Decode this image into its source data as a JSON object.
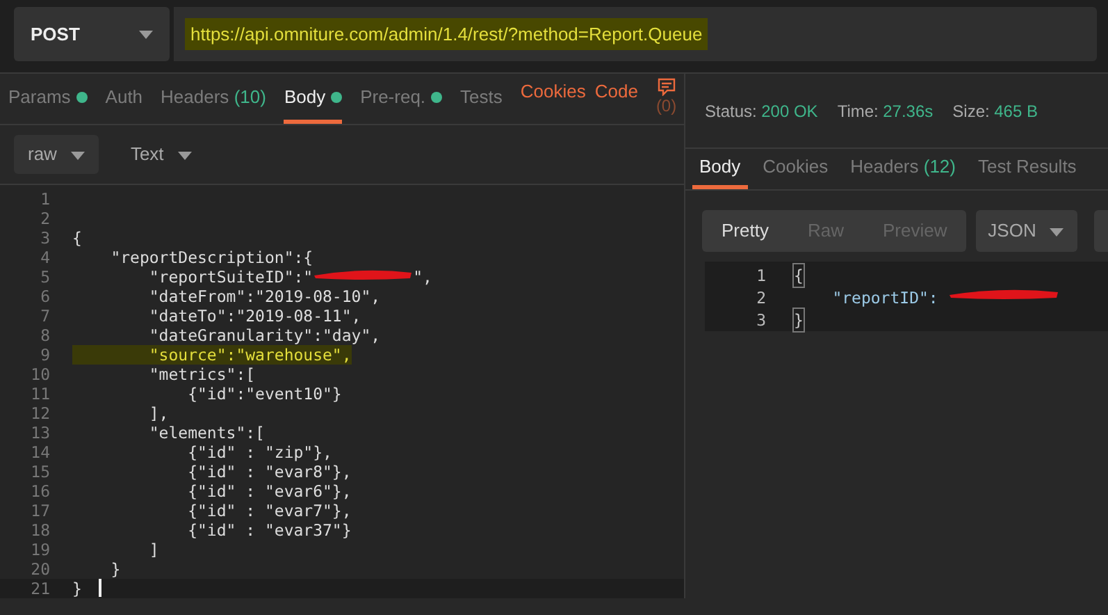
{
  "request": {
    "method": "POST",
    "url": "https://api.omniture.com/admin/1.4/rest/?method=Report.Queue",
    "url_highlighted": true
  },
  "request_tabs": [
    {
      "label": "Params",
      "dot": true,
      "selected": false
    },
    {
      "label": "Auth",
      "selected": false
    },
    {
      "label": "Headers",
      "count": "(10)",
      "selected": false
    },
    {
      "label": "Body",
      "dot": true,
      "selected": true
    },
    {
      "label": "Pre-req.",
      "dot": true,
      "selected": false
    },
    {
      "label": "Tests",
      "selected": false
    }
  ],
  "request_links": [
    "Cookies",
    "Code"
  ],
  "comments_count": "(0)",
  "body_mode": "raw",
  "body_type": "Text",
  "editor": {
    "lines": [
      {
        "number": "1"
      },
      {
        "number": "2"
      },
      {
        "number": "3",
        "text": "{"
      },
      {
        "number": "4",
        "text": "    \"reportDescription\":{"
      },
      {
        "number": "5",
        "text": "        \"reportSuiteID\":\"",
        "redacted": true,
        "after": "\","
      },
      {
        "number": "6",
        "text": "        \"dateFrom\":\"2019-08-10\","
      },
      {
        "number": "7",
        "text": "        \"dateTo\":\"2019-08-11\","
      },
      {
        "number": "8",
        "text": "        \"dateGranularity\":\"day\","
      },
      {
        "number": "9",
        "text": "        \"source\":\"warehouse\",",
        "highlighted": true
      },
      {
        "number": "10",
        "text": "        \"metrics\":["
      },
      {
        "number": "11",
        "text": "            {\"id\":\"event10\"}"
      },
      {
        "number": "12",
        "text": "        ],"
      },
      {
        "number": "13",
        "text": "        \"elements\":["
      },
      {
        "number": "14",
        "text": "            {\"id\" : \"zip\"},"
      },
      {
        "number": "15",
        "text": "            {\"id\" : \"evar8\"},"
      },
      {
        "number": "16",
        "text": "            {\"id\" : \"evar6\"},"
      },
      {
        "number": "17",
        "text": "            {\"id\" : \"evar7\"},"
      },
      {
        "number": "18",
        "text": "            {\"id\" : \"evar37\"}"
      },
      {
        "number": "19",
        "text": "        ]"
      },
      {
        "number": "20",
        "text": "    }"
      },
      {
        "number": "21",
        "text": "}",
        "cursor": true
      }
    ]
  },
  "response": {
    "status_label": "Status:",
    "status": "200 OK",
    "time_label": "Time:",
    "time": "27.36s",
    "size_label": "Size:",
    "size": "465 B",
    "tabs": [
      {
        "label": "Body",
        "selected": true
      },
      {
        "label": "Cookies",
        "selected": false
      },
      {
        "label": "Headers",
        "count": "(12)",
        "selected": false
      },
      {
        "label": "Test Results",
        "selected": false
      }
    ],
    "views": [
      {
        "label": "Pretty",
        "selected": true
      },
      {
        "label": "Raw",
        "selected": false
      },
      {
        "label": "Preview",
        "selected": false
      }
    ],
    "format": "JSON",
    "lines": [
      {
        "number": "1",
        "text": "{",
        "matched": true
      },
      {
        "number": "2",
        "text": "    \"reportID\": ",
        "redacted": true
      },
      {
        "number": "3",
        "text": "}",
        "matched": true
      }
    ]
  }
}
